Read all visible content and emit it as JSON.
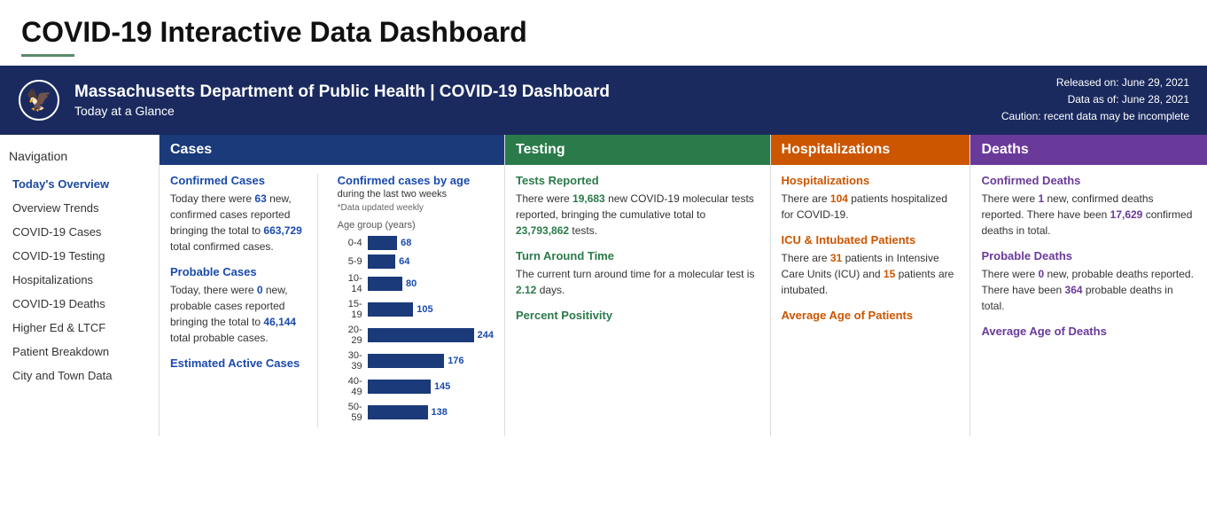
{
  "page": {
    "title": "COVID-19 Interactive Data Dashboard",
    "title_underline_color": "#5a8a6a"
  },
  "banner": {
    "main": "Massachusetts Department of Public Health  |  COVID-19 Dashboard",
    "sub": "Today at a Glance",
    "released": "Released on: June 29, 2021",
    "data_as_of": "Data as of: June 28, 2021",
    "caution": "Caution: recent data may be incomplete"
  },
  "sidebar": {
    "title": "Navigation",
    "items": [
      {
        "label": "Today's Overview",
        "active": true
      },
      {
        "label": "Overview Trends",
        "active": false
      },
      {
        "label": "COVID-19 Cases",
        "active": false
      },
      {
        "label": "COVID-19 Testing",
        "active": false
      },
      {
        "label": "Hospitalizations",
        "active": false
      },
      {
        "label": "COVID-19 Deaths",
        "active": false
      },
      {
        "label": "Higher Ed & LTCF",
        "active": false
      },
      {
        "label": "Patient Breakdown",
        "active": false
      },
      {
        "label": "City and Town Data",
        "active": false
      }
    ]
  },
  "panels": {
    "cases": {
      "header": "Cases",
      "confirmed_cases_link": "Confirmed Cases",
      "confirmed_text_before": "Today there were ",
      "confirmed_new": "63",
      "confirmed_text_mid": " new, confirmed cases reported bringing the total to ",
      "confirmed_total": "663,729",
      "confirmed_text_end": " total confirmed cases.",
      "probable_cases_link": "Probable Cases",
      "probable_text_before": "Today, there were ",
      "probable_new": "0",
      "probable_text_mid": " new, probable cases reported bringing the total to ",
      "probable_total": "46,144",
      "probable_text_end": " total probable cases.",
      "estimated_active_link": "Estimated Active Cases",
      "chart": {
        "title": "Confirmed cases by age",
        "subtitle": "during the last two weeks",
        "note": "*Data updated weekly",
        "axis_label": "Age group (years)",
        "bars": [
          {
            "age": "0-4",
            "value": 68,
            "max": 244
          },
          {
            "age": "5-9",
            "value": 64,
            "max": 244
          },
          {
            "age": "10-14",
            "value": 80,
            "max": 244
          },
          {
            "age": "15-19",
            "value": 105,
            "max": 244
          },
          {
            "age": "20-29",
            "value": 244,
            "max": 244
          },
          {
            "age": "30-39",
            "value": 176,
            "max": 244
          },
          {
            "age": "40-49",
            "value": 145,
            "max": 244
          },
          {
            "age": "50-59",
            "value": 138,
            "max": 244
          }
        ]
      }
    },
    "testing": {
      "header": "Testing",
      "tests_reported_link": "Tests Reported",
      "tests_text_before": "There were ",
      "tests_new": "19,683",
      "tests_text_mid": " new COVID-19 molecular tests reported, bringing the cumulative total to ",
      "tests_total": "23,793,862",
      "tests_text_end": " tests.",
      "turnaround_link": "Turn Around Time",
      "turnaround_text_before": "The current turn around time for a molecular test is ",
      "turnaround_value": "2.12",
      "turnaround_text_end": " days.",
      "percent_positivity_link": "Percent Positivity"
    },
    "hospitalizations": {
      "header": "Hospitalizations",
      "hosp_link": "Hospitalizations",
      "hosp_text_before": "There are ",
      "hosp_count": "104",
      "hosp_text_end": " patients hospitalized for COVID-19.",
      "icu_link": "ICU & Intubated Patients",
      "icu_text_before": "There are ",
      "icu_count": "31",
      "icu_text_mid": " patients in Intensive Care Units (ICU) and ",
      "intubated_count": "15",
      "icu_text_end": " patients are intubated.",
      "avg_age_link": "Average Age of Patients"
    },
    "deaths": {
      "header": "Deaths",
      "confirmed_deaths_link": "Confirmed Deaths",
      "confirmed_text_before": "There were ",
      "confirmed_new": "1",
      "confirmed_text_mid": " new, confirmed deaths reported. There have been ",
      "confirmed_total": "17,629",
      "confirmed_text_end": " confirmed deaths in total.",
      "probable_deaths_link": "Probable Deaths",
      "probable_text_before": "There were ",
      "probable_new": "0",
      "probable_text_mid": " new, probable deaths reported. There have been ",
      "probable_total": "364",
      "probable_text_end": " probable deaths in total.",
      "avg_age_link": "Average Age of Deaths"
    }
  }
}
